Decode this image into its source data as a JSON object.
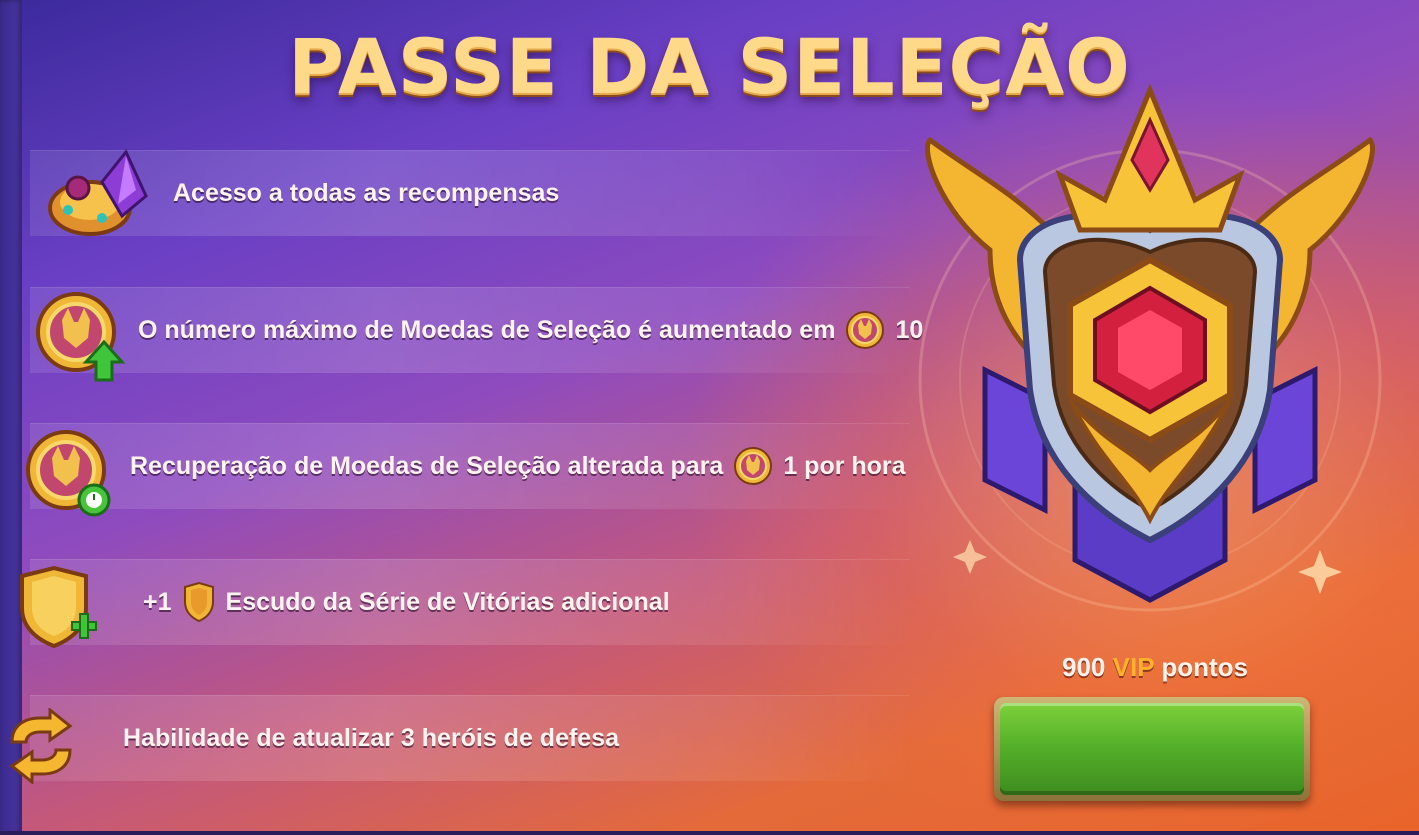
{
  "title": "PASSE DA SELEÇÃO",
  "rows": [
    {
      "icon": "rewards-chest-icon",
      "text": "Acesso a todas as recompensas"
    },
    {
      "icon": "coin-increase-icon",
      "text_before": "O número máximo de Moedas de Seleção é aumentado em",
      "inline_icon": "selection-coin-icon",
      "value": "10"
    },
    {
      "icon": "coin-timer-icon",
      "text_before": "Recuperação de Moedas de Seleção alterada para",
      "inline_icon": "selection-coin-icon",
      "value": "1 por hora"
    },
    {
      "icon": "shield-plus-icon",
      "prefix": "+1",
      "inline_icon": "win-streak-shield-icon",
      "text_after": "Escudo da Série de Vitórias adicional"
    },
    {
      "icon": "refresh-arrows-icon",
      "text": "Habilidade de atualizar 3 heróis de defesa"
    }
  ],
  "vip": {
    "amount": "900",
    "vip_word": "VIP",
    "suffix": "pontos"
  },
  "buy_button": {
    "label": ""
  },
  "colors": {
    "accent_gold": "#ffd98a",
    "vip_orange": "#ffb12b",
    "button_green": "#55b12a"
  }
}
